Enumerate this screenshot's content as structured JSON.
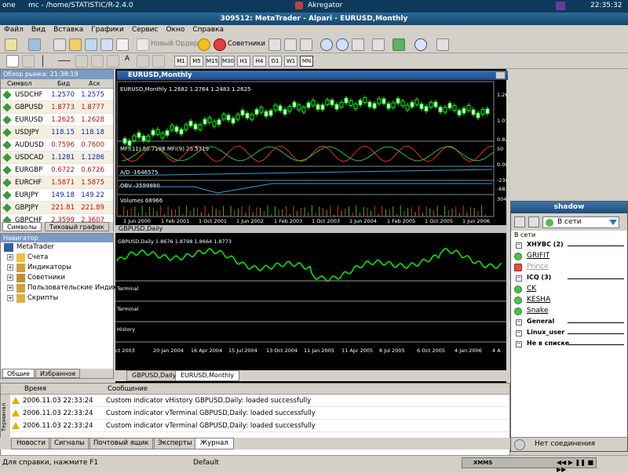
{
  "sysbar": {
    "left1": "one",
    "left2": "mc - /home/STATISTIC/R-2.4.0",
    "center": "Akregator",
    "clock": "22:35:32"
  },
  "window": {
    "title": "309512: MetaTrader - Alpari - EURUSD,Monthly"
  },
  "menu": [
    "Файл",
    "Вид",
    "Вставка",
    "Графики",
    "Сервис",
    "Окно",
    "Справка"
  ],
  "toolbar": {
    "new_order": "Новый Ордер",
    "advisors": "Советники"
  },
  "timeframes": [
    "M1",
    "M5",
    "M15",
    "M30",
    "H1",
    "H4",
    "D1",
    "W1",
    "MN"
  ],
  "market_watch": {
    "title": "Обзор рынка: 21:38:19",
    "cols": [
      "Символ",
      "Бид",
      "Аск"
    ],
    "rows": [
      {
        "sym": "USDCHF",
        "bid": "1.2570",
        "ask": "1.2575",
        "dir": "up"
      },
      {
        "sym": "GBPUSD",
        "bid": "1.8773",
        "ask": "1.8777",
        "dir": "dn"
      },
      {
        "sym": "EURUSD",
        "bid": "1.2625",
        "ask": "1.2628",
        "dir": "dn"
      },
      {
        "sym": "USDJPY",
        "bid": "118.15",
        "ask": "118.18",
        "dir": "up"
      },
      {
        "sym": "AUDUSD",
        "bid": "0.7596",
        "ask": "0.7600",
        "dir": "dn"
      },
      {
        "sym": "USDCAD",
        "bid": "1.1281",
        "ask": "1.1286",
        "dir": "up"
      },
      {
        "sym": "EURGBP",
        "bid": "0.6722",
        "ask": "0.6726",
        "dir": "dn"
      },
      {
        "sym": "EURCHF",
        "bid": "1.5871",
        "ask": "1.5875",
        "dir": "dn"
      },
      {
        "sym": "EURJPY",
        "bid": "149.18",
        "ask": "149.22",
        "dir": "up"
      },
      {
        "sym": "GBPJPY",
        "bid": "221.81",
        "ask": "221.89",
        "dir": "dn"
      },
      {
        "sym": "GBPCHF",
        "bid": "2.3599",
        "ask": "2.3607",
        "dir": "dn"
      }
    ],
    "tabs": [
      "Символы",
      "Тиковый график"
    ]
  },
  "navigator": {
    "title": "Навигатор",
    "root": "MetaTrader",
    "items": [
      "Счета",
      "Индикаторы",
      "Советники",
      "Пользовательские Индикато",
      "Скрипты"
    ],
    "tabs": [
      "Общие",
      "Избранное"
    ]
  },
  "chart1": {
    "title": "EURUSD,Monthly",
    "info": "EURUSD,Monthly  1.2682 1.2764 1.2483 1.2625",
    "mfi": "MFI(11) 50.7188  MFI(9) 25.5719",
    "ad": "A/D -1646575",
    "obv": "OBV -3599880",
    "vol": "Volumes 68966",
    "prices": [
      "1.2625",
      "1.0180",
      "0.8200"
    ],
    "mfi_levels": [
      "50",
      "0.00"
    ],
    "ad_levels": [
      "-230466",
      "-683112"
    ],
    "vol_level": "304666",
    "dates": [
      "1 Jun 2000",
      "1 Feb 2001",
      "1 Oct 2001",
      "1 Jun 2002",
      "1 Feb 2003",
      "1 Oct 2003",
      "1 Jun 2004",
      "1 Feb 2005",
      "1 Oct 2005",
      "1 Jun 2006"
    ]
  },
  "chart2": {
    "title": "GBPUSD,Daily",
    "info": "GBPUSD,Daily  1.8676 1.8798 1.8664 1.8773",
    "panes": [
      "Terminal",
      "Terminal",
      "History"
    ],
    "dates": [
      "ct 2003",
      "20 Jan 2004",
      "16 Apr 2004",
      "15 Jul 2004",
      "13 Oct 2004",
      "11 Jan 2005",
      "11 Apr 2005",
      "8 Jul 2005",
      "6 Oct 2005",
      "4 Jan 2006",
      "4 A"
    ]
  },
  "chart_tabs": [
    "GBPUSD,Daily",
    "EURUSD,Monthly"
  ],
  "terminal": {
    "cols": [
      "Время",
      "Сообщение"
    ],
    "side_label": "Терминал",
    "rows": [
      {
        "time": "2006.11.03 22:33:24",
        "msg": "Custom indicator vHistory GBPUSD,Daily: loaded successfully"
      },
      {
        "time": "2006.11.03 22:33:24",
        "msg": "Custom indicator vTerminal GBPUSD,Daily: loaded successfully"
      },
      {
        "time": "2006.11.03 22:33:24",
        "msg": "Custom indicator vTerminal GBPUSD,Daily: loaded successfully"
      }
    ],
    "tabs": [
      "Новости",
      "Сигналы",
      "Почтовый ящик",
      "Эксперты",
      "Журнал"
    ]
  },
  "status": {
    "help": "Для справки, нажмите F1",
    "profile": "Default",
    "xmms": "XMMS"
  },
  "shadow": {
    "title": "shadow",
    "status": "В сети",
    "section": "В сети",
    "groups": [
      {
        "name": "ХНУВС (2)",
        "contacts": [
          "GRIFIT",
          "Prince"
        ]
      },
      {
        "name": "ICQ (3)",
        "contacts": [
          "CK",
          "KESHA",
          "Snake"
        ]
      },
      {
        "name": "General",
        "contacts": []
      },
      {
        "name": "Linux_user",
        "contacts": []
      },
      {
        "name": "Не в списке",
        "contacts": []
      }
    ],
    "bottom": "Нет соединения"
  }
}
